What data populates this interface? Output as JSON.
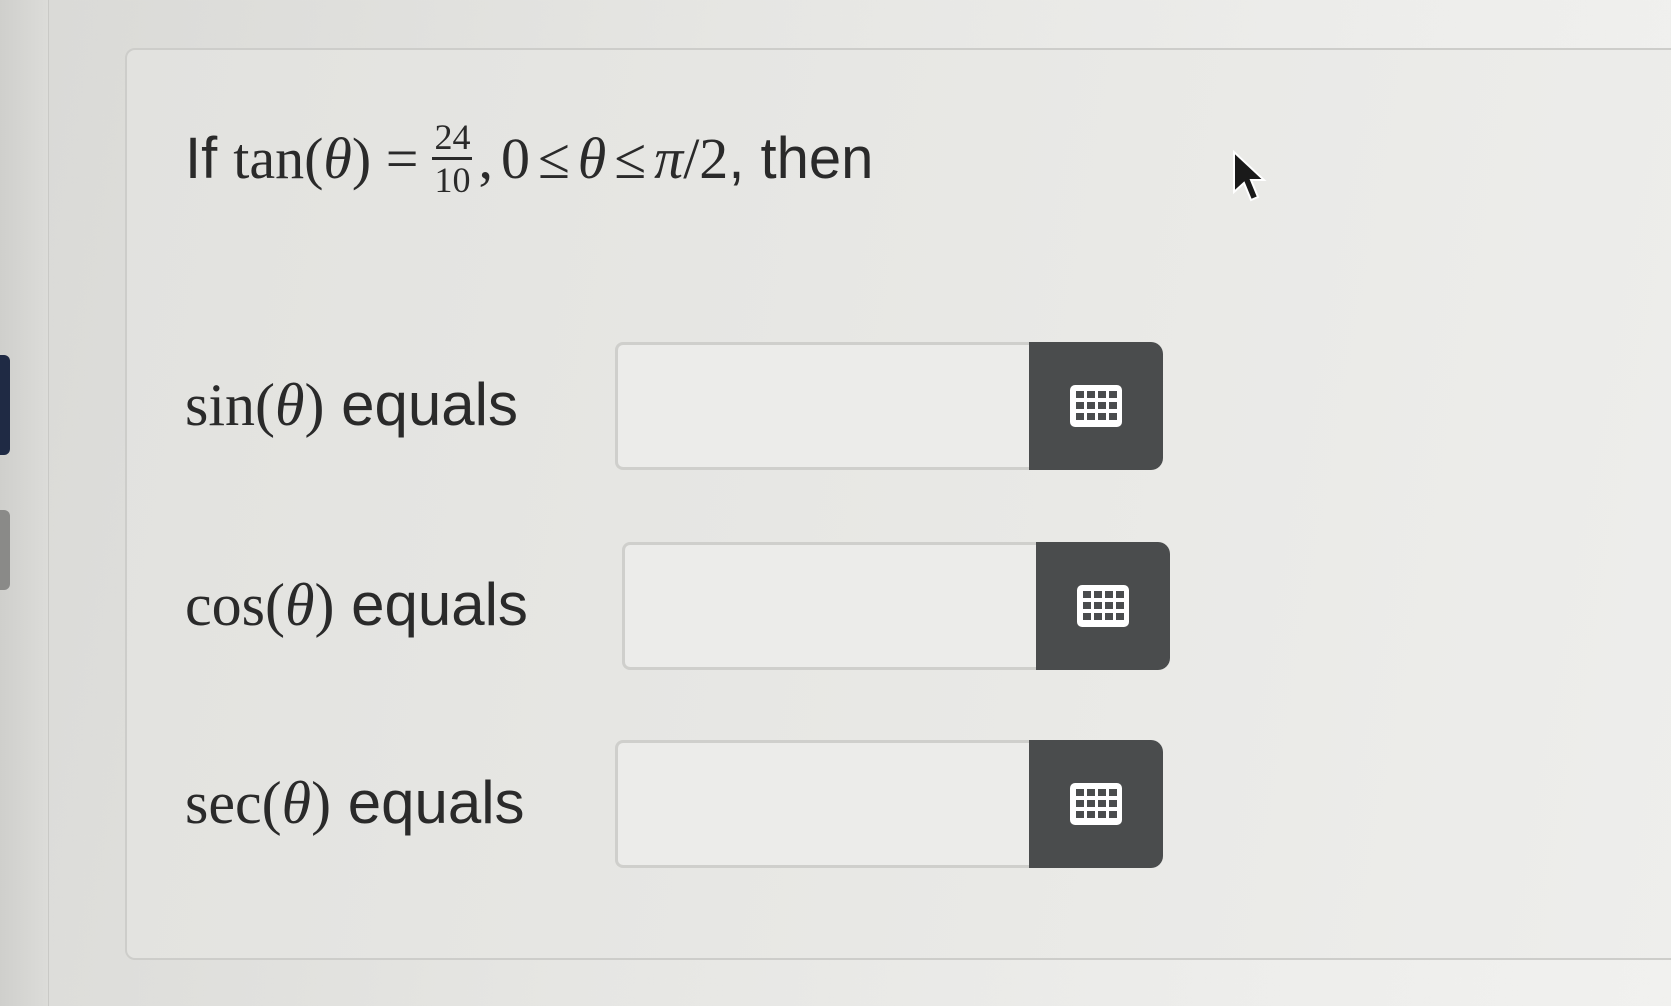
{
  "question": {
    "prefix": "If",
    "func": "tan(",
    "theta": "θ",
    "func_close": ") =",
    "fraction": {
      "numerator": "24",
      "denominator": "10"
    },
    "condition_sep": ",",
    "cond_zero": "0",
    "leq": "≤",
    "cond_pi": "π",
    "cond_over": "/2",
    "suffix": ", then"
  },
  "answers": [
    {
      "func": "sin(",
      "theta": "θ",
      "close": ")",
      "word": "equals",
      "value": "",
      "placeholder": "",
      "keypad_icon": "keypad-icon"
    },
    {
      "func": "cos(",
      "theta": "θ",
      "close": ")",
      "word": "equals",
      "value": "",
      "placeholder": "",
      "keypad_icon": "keypad-icon"
    },
    {
      "func": "sec(",
      "theta": "θ",
      "close": ")",
      "word": "equals",
      "value": "",
      "placeholder": "",
      "keypad_icon": "keypad-icon"
    }
  ],
  "colors": {
    "keypad_bg": "#4a4c4d",
    "text": "#2a2a2a",
    "card_bg": "#e6e6e3"
  }
}
